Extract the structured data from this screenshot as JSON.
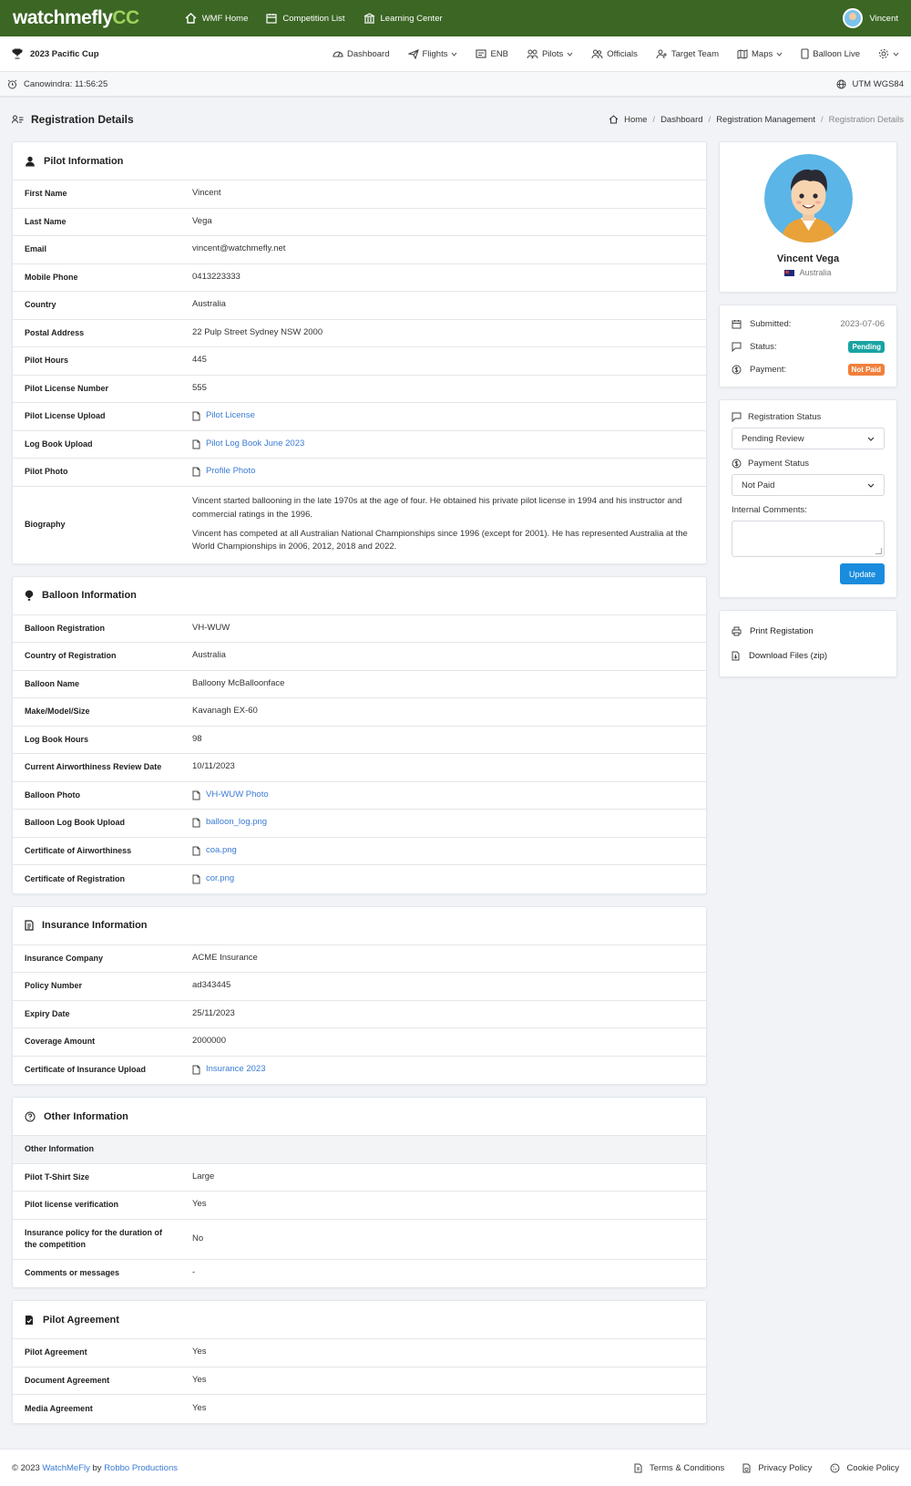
{
  "topbar": {
    "logo_main": "watchmefly",
    "logo_accent": "CC",
    "nav": [
      "WMF Home",
      "Competition List",
      "Learning Center"
    ],
    "user": "Vincent"
  },
  "subbar": {
    "competition": "2023 Pacific Cup",
    "nav": [
      "Dashboard",
      "Flights",
      "ENB",
      "Pilots",
      "Officials",
      "Target Team",
      "Maps",
      "Balloon Live"
    ]
  },
  "infobar": {
    "location_time": "Canowindra: 11:56:25",
    "coords": "UTM WGS84"
  },
  "header": {
    "title": "Registration Details",
    "breadcrumb": [
      "Home",
      "Dashboard",
      "Registration Management",
      "Registration Details"
    ]
  },
  "pilot": {
    "title": "Pilot Information",
    "first_name": {
      "label": "First Name",
      "value": "Vincent"
    },
    "last_name": {
      "label": "Last Name",
      "value": "Vega"
    },
    "email": {
      "label": "Email",
      "value": "vincent@watchmefly.net"
    },
    "mobile": {
      "label": "Mobile Phone",
      "value": "0413223333"
    },
    "country": {
      "label": "Country",
      "value": "Australia"
    },
    "address": {
      "label": "Postal Address",
      "value": "22 Pulp Street Sydney NSW 2000"
    },
    "hours": {
      "label": "Pilot Hours",
      "value": "445"
    },
    "license_number": {
      "label": "Pilot License Number",
      "value": "555"
    },
    "license_upload": {
      "label": "Pilot License Upload",
      "value": "Pilot License"
    },
    "logbook_upload": {
      "label": "Log Book Upload",
      "value": "Pilot Log Book June 2023"
    },
    "photo": {
      "label": "Pilot Photo",
      "value": "Profile Photo"
    },
    "biography": {
      "label": "Biography",
      "p1": "Vincent started ballooning in the late 1970s at the age of four. He obtained his private pilot license in 1994 and his instructor and commercial ratings in the 1996.",
      "p2": "Vincent has competed at all Australian National Championships since 1996 (except for 2001). He has represented Australia at the World Championships in 2006, 2012, 2018 and 2022."
    }
  },
  "balloon": {
    "title": "Balloon Information",
    "registration": {
      "label": "Balloon Registration",
      "value": "VH-WUW"
    },
    "country": {
      "label": "Country of Registration",
      "value": "Australia"
    },
    "name": {
      "label": "Balloon Name",
      "value": "Balloony McBalloonface"
    },
    "model": {
      "label": "Make/Model/Size",
      "value": "Kavanagh EX-60"
    },
    "logbook_hours": {
      "label": "Log Book Hours",
      "value": "98"
    },
    "review_date": {
      "label": "Current Airworthiness Review Date",
      "value": "10/11/2023"
    },
    "photo": {
      "label": "Balloon Photo",
      "value": "VH-WUW Photo"
    },
    "logbook_upload": {
      "label": "Balloon Log Book Upload",
      "value": "balloon_log.png"
    },
    "coa": {
      "label": "Certificate of Airworthiness",
      "value": "coa.png"
    },
    "cor": {
      "label": "Certificate of Registration",
      "value": "cor.png"
    }
  },
  "insurance": {
    "title": "Insurance Information",
    "company": {
      "label": "Insurance Company",
      "value": "ACME Insurance"
    },
    "policy": {
      "label": "Policy Number",
      "value": "ad343445"
    },
    "expiry": {
      "label": "Expiry Date",
      "value": "25/11/2023"
    },
    "coverage": {
      "label": "Coverage Amount",
      "value": "2000000"
    },
    "certificate": {
      "label": "Certificate of Insurance Upload",
      "value": "Insurance 2023"
    }
  },
  "other": {
    "title": "Other Information",
    "subheader": "Other Information",
    "tshirt": {
      "label": "Pilot T-Shirt Size",
      "value": "Large"
    },
    "verification": {
      "label": "Pilot license verification",
      "value": "Yes"
    },
    "policy_duration": {
      "label": "Insurance policy for the duration of the competition",
      "value": "No"
    },
    "comments": {
      "label": "Comments or messages",
      "value": "-"
    }
  },
  "agreement": {
    "title": "Pilot Agreement",
    "pilot": {
      "label": "Pilot Agreement",
      "value": "Yes"
    },
    "document": {
      "label": "Document Agreement",
      "value": "Yes"
    },
    "media": {
      "label": "Media Agreement",
      "value": "Yes"
    }
  },
  "profile": {
    "name": "Vincent Vega",
    "country": "Australia"
  },
  "meta": {
    "submitted_label": "Submitted:",
    "submitted_value": "2023-07-06",
    "status_label": "Status:",
    "status_value": "Pending",
    "status_color": "#1aa3a3",
    "payment_label": "Payment:",
    "payment_value": "Not Paid",
    "payment_color": "#f0803c"
  },
  "form": {
    "reg_status_label": "Registration Status",
    "reg_status_value": "Pending Review",
    "payment_status_label": "Payment Status",
    "payment_status_value": "Not Paid",
    "comments_label": "Internal Comments:",
    "update_label": "Update"
  },
  "actions": {
    "print": "Print Registation",
    "download": "Download Files (zip)"
  },
  "footer": {
    "copyright": "© 2023",
    "brand": "WatchMeFly",
    "by": "by",
    "company": "Robbo Productions",
    "links": [
      "Terms & Conditions",
      "Privacy Policy",
      "Cookie Policy"
    ]
  },
  "colors": {
    "topbar": "#3b6624",
    "link": "#3a7bd5",
    "update_button": "#1a8cdd"
  }
}
